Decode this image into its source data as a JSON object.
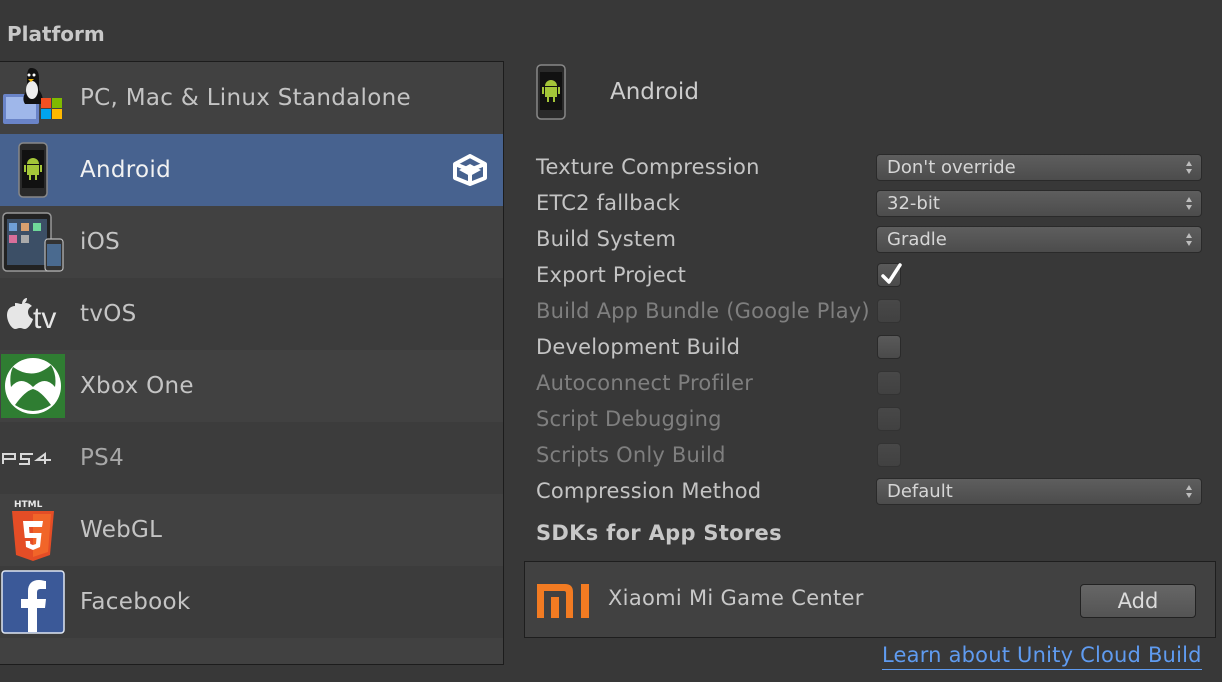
{
  "platform_heading": "Platform",
  "platforms": [
    {
      "label": "PC, Mac & Linux Standalone",
      "icon": "standalone-icon"
    },
    {
      "label": "Android",
      "icon": "android-phone-icon",
      "selected": true
    },
    {
      "label": "iOS",
      "icon": "ios-devices-icon"
    },
    {
      "label": "tvOS",
      "icon": "apple-tv-icon"
    },
    {
      "label": "Xbox One",
      "icon": "xbox-icon"
    },
    {
      "label": "PS4",
      "icon": "ps4-icon"
    },
    {
      "label": "WebGL",
      "icon": "html5-icon"
    },
    {
      "label": "Facebook",
      "icon": "facebook-icon"
    }
  ],
  "selected_platform": {
    "title": "Android",
    "icon": "android-phone-icon"
  },
  "settings": {
    "texture_compression": {
      "label": "Texture Compression",
      "value": "Don't override"
    },
    "etc2_fallback": {
      "label": "ETC2 fallback",
      "value": "32-bit"
    },
    "build_system": {
      "label": "Build System",
      "value": "Gradle"
    },
    "export_project": {
      "label": "Export Project",
      "checked": true
    },
    "build_app_bundle": {
      "label": "Build App Bundle (Google Play)",
      "checked": false,
      "disabled": true
    },
    "development_build": {
      "label": "Development Build",
      "checked": false
    },
    "autoconnect_profiler": {
      "label": "Autoconnect Profiler",
      "checked": false,
      "disabled": true
    },
    "script_debugging": {
      "label": "Script Debugging",
      "checked": false,
      "disabled": true
    },
    "scripts_only_build": {
      "label": "Scripts Only Build",
      "checked": false,
      "disabled": true
    },
    "compression_method": {
      "label": "Compression Method",
      "value": "Default"
    }
  },
  "sdks": {
    "heading": "SDKs for App Stores",
    "items": [
      {
        "name": "Xiaomi Mi Game Center",
        "icon": "xiaomi-mi-icon",
        "button": "Add"
      }
    ]
  },
  "cloud_build_link": "Learn about Unity Cloud Build",
  "colors": {
    "background": "#383838",
    "selected_row": "#47628f",
    "link": "#5f9bf0",
    "xbox_green": "#2f7d32",
    "html5_orange": "#e44d26",
    "facebook_blue": "#3b5998",
    "mi_orange": "#f27b22"
  }
}
